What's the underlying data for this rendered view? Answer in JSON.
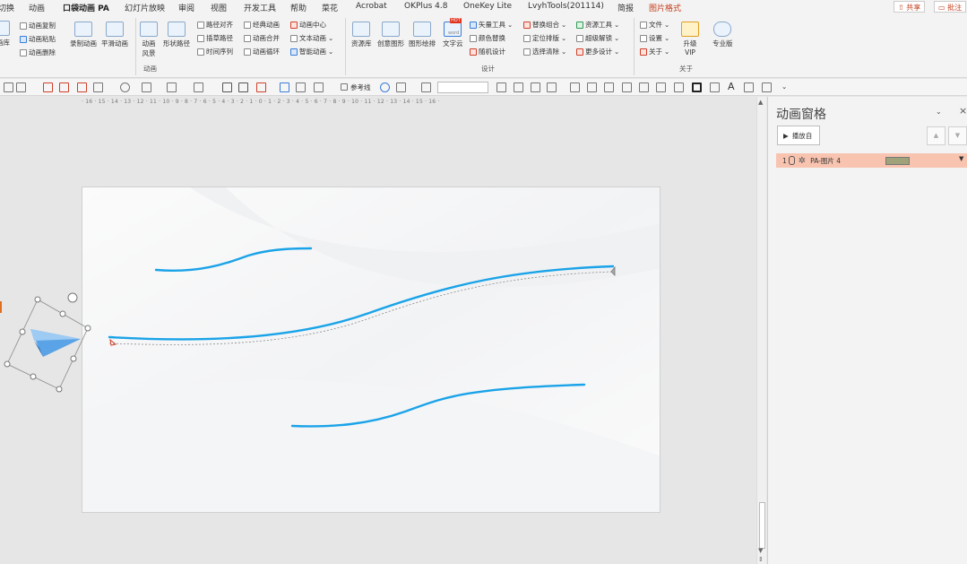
{
  "tabs": [
    {
      "label": "切换",
      "active": false
    },
    {
      "label": "动画",
      "active": false
    },
    {
      "label": "口袋动画 PA",
      "active": true
    },
    {
      "label": "幻灯片放映",
      "active": false
    },
    {
      "label": "审阅",
      "active": false
    },
    {
      "label": "视图",
      "active": false
    },
    {
      "label": "开发工具",
      "active": false
    },
    {
      "label": "帮助",
      "active": false
    },
    {
      "label": "菜花",
      "active": false
    },
    {
      "label": "Acrobat",
      "active": false
    },
    {
      "label": "OKPlus 4.8",
      "active": false
    },
    {
      "label": "OneKey Lite",
      "active": false
    },
    {
      "label": "LvyhTools(201114)",
      "active": false
    },
    {
      "label": "简报",
      "active": false
    },
    {
      "label": "图片格式",
      "active": false
    }
  ],
  "top_right": {
    "share": "共享",
    "comment": "批注"
  },
  "ribbon": {
    "left_partial": "画库",
    "copy_items": [
      "动画复制",
      "动画粘贴",
      "动画删除"
    ],
    "record": "录制动画",
    "smooth": "平滑动画",
    "style_line1": "动画",
    "style_line2": "风景",
    "shape_path": "形状路径",
    "col2": [
      "路径对齐",
      "插草路径",
      "时间序列"
    ],
    "col3": [
      "经典动画",
      "动画合并",
      "动画循环"
    ],
    "col4": [
      "动画中心",
      "文本动画",
      "智能动画"
    ],
    "group_anim": "动画",
    "resource": "资源库",
    "creative": "创意图形",
    "shape_draw": "图形绘排",
    "word_cloud": "文字云",
    "hot": "HOT",
    "word_tag": "word",
    "col5": [
      "矢量工具",
      "颜色替换",
      "随机设计"
    ],
    "col6": [
      "替换组合",
      "定位排版",
      "选择清除"
    ],
    "col7": [
      "资源工具",
      "超级解锁",
      "更多设计"
    ],
    "group_design": "设计",
    "file": "文件",
    "settings": "设置",
    "about": "关于",
    "upgrade_line1": "升级",
    "upgrade_line2": "VIP",
    "pro": "专业版",
    "group_about": "关于"
  },
  "toolbar": {
    "guides": "参考线"
  },
  "ruler": "· 16 · 15 · 14 · 13 · 12 · 11 · 10 · 9 · 8 · 7 · 6 · 5 · 4 · 3 · 2 · 1 · 0 · 1 · 2 · 3 · 4 · 5 · 6 · 7 · 8 · 9 · 10 · 11 · 12 · 13 · 14 · 15 · 16 ·",
  "pane": {
    "title": "动画窗格",
    "play_from": "播放自",
    "items": [
      {
        "num": "1",
        "name": "PA-图片 4"
      }
    ]
  },
  "colors": {
    "accent": "#c43e1c",
    "selected_item": "#f8c4b0",
    "curve": "#1aa3e8"
  }
}
